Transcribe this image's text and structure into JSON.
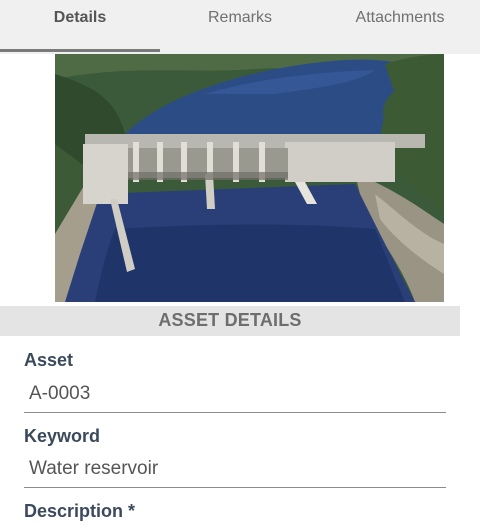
{
  "tabs": [
    {
      "label": "Details",
      "active": true
    },
    {
      "label": "Remarks",
      "active": false
    },
    {
      "label": "Attachments",
      "active": false
    }
  ],
  "section": {
    "title": "ASSET DETAILS"
  },
  "fields": {
    "asset": {
      "label": "Asset",
      "value": "A-0003"
    },
    "keyword": {
      "label": "Keyword",
      "value": "Water reservoir"
    },
    "description": {
      "label": "Description *"
    }
  },
  "image": {
    "subject": "dam-reservoir-photo"
  },
  "colors": {
    "tabbar_bg": "#f0f0f0",
    "section_bg": "#e4e4e4",
    "label": "#3a4a5c",
    "value": "#555555"
  }
}
